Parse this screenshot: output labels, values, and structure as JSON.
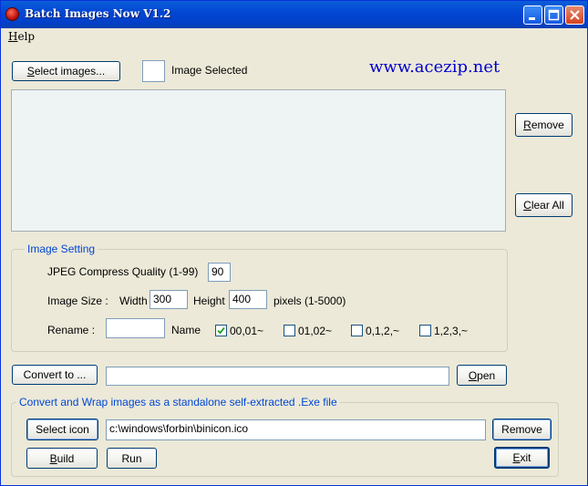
{
  "window": {
    "title": "Batch Images Now V1.2"
  },
  "menu": {
    "help": "Help"
  },
  "select_images": {
    "label": "Select images..."
  },
  "image_selected_label": "Image Selected",
  "website": "www.acezip.net",
  "list": {
    "remove": "Remove",
    "clear_all": "Clear All"
  },
  "image_setting": {
    "title": "Image Setting",
    "quality_label": "JPEG Compress Quality (1-99)",
    "quality_value": "90",
    "size_label": "Image Size :",
    "width_label": "Width",
    "width_value": "300",
    "height_label": "Height",
    "height_value": "400",
    "pixels_label": "pixels (1-5000)",
    "rename_label": "Rename :",
    "rename_value": "",
    "name_label": "Name",
    "options": [
      {
        "label": "00,01~",
        "checked": true
      },
      {
        "label": "01,02~",
        "checked": false
      },
      {
        "label": "0,1,2,~",
        "checked": false
      },
      {
        "label": "1,2,3,~",
        "checked": false
      }
    ]
  },
  "convert": {
    "button": "Convert to ...",
    "path": "",
    "open": "Open"
  },
  "wrap": {
    "title": "Convert and Wrap images as a standalone self-extracted .Exe file",
    "select_icon": "Select icon",
    "icon_path": "c:\\windows\\forbin\\binicon.ico",
    "remove": "Remove",
    "build": "Build",
    "run": "Run",
    "exit": "Exit"
  }
}
